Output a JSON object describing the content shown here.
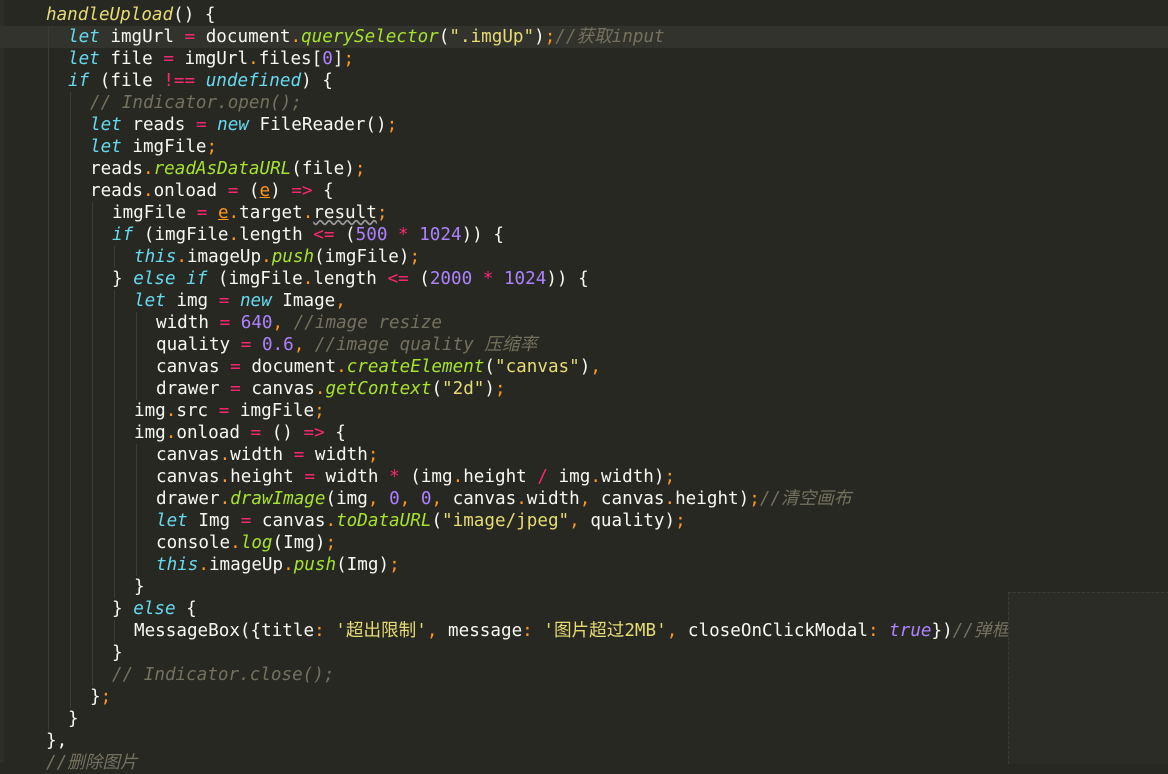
{
  "editor": {
    "theme_colors": {
      "background": "#272822",
      "keyword": "#66d9ef",
      "operator": "#f92672",
      "function": "#a6e22e",
      "string": "#e6db74",
      "number": "#ae81ff",
      "comment": "#75715e"
    },
    "lines": [
      {
        "indent": 1,
        "tokens": [
          [
            "fnm",
            "handleUpload"
          ],
          [
            "pu",
            "() {"
          ]
        ]
      },
      {
        "indent": 2,
        "current": true,
        "tokens": [
          [
            "kw",
            "let"
          ],
          [
            "pu",
            " imgUrl "
          ],
          [
            "op",
            "="
          ],
          [
            "pu",
            " document"
          ],
          [
            "sep",
            "."
          ],
          [
            "fn",
            "querySelector"
          ],
          [
            "pu",
            "("
          ],
          [
            "str",
            "\".imgUp\""
          ],
          [
            "pu",
            ")"
          ],
          [
            "sep",
            ";"
          ],
          [
            "cm",
            "//获取input"
          ]
        ]
      },
      {
        "indent": 2,
        "tokens": [
          [
            "kw",
            "let"
          ],
          [
            "pu",
            " file "
          ],
          [
            "op",
            "="
          ],
          [
            "pu",
            " imgUrl"
          ],
          [
            "sep",
            "."
          ],
          [
            "pu",
            "files["
          ],
          [
            "num",
            "0"
          ],
          [
            "pu",
            "]"
          ],
          [
            "sep",
            ";"
          ]
        ]
      },
      {
        "indent": 2,
        "tokens": [
          [
            "kw",
            "if"
          ],
          [
            "pu",
            " (file "
          ],
          [
            "op",
            "!=="
          ],
          [
            "pu",
            " "
          ],
          [
            "kw",
            "undefined"
          ],
          [
            "pu",
            ") {"
          ]
        ]
      },
      {
        "indent": 3,
        "tokens": [
          [
            "cm",
            "// Indicator.open();"
          ]
        ]
      },
      {
        "indent": 3,
        "tokens": [
          [
            "kw",
            "let"
          ],
          [
            "pu",
            " reads "
          ],
          [
            "op",
            "="
          ],
          [
            "pu",
            " "
          ],
          [
            "kw",
            "new"
          ],
          [
            "pu",
            " FileReader()"
          ],
          [
            "sep",
            ";"
          ]
        ]
      },
      {
        "indent": 3,
        "tokens": [
          [
            "kw",
            "let"
          ],
          [
            "pu",
            " imgFile"
          ],
          [
            "sep",
            ";"
          ]
        ]
      },
      {
        "indent": 3,
        "tokens": [
          [
            "pu",
            "reads"
          ],
          [
            "sep",
            "."
          ],
          [
            "fn",
            "readAsDataURL"
          ],
          [
            "pu",
            "(file)"
          ],
          [
            "sep",
            ";"
          ]
        ]
      },
      {
        "indent": 3,
        "tokens": [
          [
            "pu",
            "reads"
          ],
          [
            "sep",
            "."
          ],
          [
            "pu",
            "onload "
          ],
          [
            "op",
            "="
          ],
          [
            "pu",
            " ("
          ],
          [
            "param",
            "e"
          ],
          [
            "pu",
            ") "
          ],
          [
            "op",
            "=>"
          ],
          [
            "pu",
            " {"
          ]
        ]
      },
      {
        "indent": 4,
        "tokens": [
          [
            "pu",
            "imgFile "
          ],
          [
            "op",
            "="
          ],
          [
            "pu",
            " "
          ],
          [
            "param",
            "e"
          ],
          [
            "sep",
            "."
          ],
          [
            "pu",
            "target"
          ],
          [
            "sep",
            "."
          ],
          [
            "squig",
            "result"
          ],
          [
            "sep",
            ";"
          ]
        ]
      },
      {
        "indent": 4,
        "tokens": [
          [
            "kw",
            "if"
          ],
          [
            "pu",
            " (imgFile"
          ],
          [
            "sep",
            "."
          ],
          [
            "pu",
            "length "
          ],
          [
            "op",
            "<="
          ],
          [
            "pu",
            " ("
          ],
          [
            "num",
            "500"
          ],
          [
            "pu",
            " "
          ],
          [
            "op",
            "*"
          ],
          [
            "pu",
            " "
          ],
          [
            "num",
            "1024"
          ],
          [
            "pu",
            ")) {"
          ]
        ]
      },
      {
        "indent": 5,
        "tokens": [
          [
            "kw",
            "this"
          ],
          [
            "sep",
            "."
          ],
          [
            "pu",
            "imageUp"
          ],
          [
            "sep",
            "."
          ],
          [
            "fn",
            "push"
          ],
          [
            "pu",
            "(imgFile)"
          ],
          [
            "sep",
            ";"
          ]
        ]
      },
      {
        "indent": 4,
        "tokens": [
          [
            "pu",
            "} "
          ],
          [
            "kw",
            "else if"
          ],
          [
            "pu",
            " (imgFile"
          ],
          [
            "sep",
            "."
          ],
          [
            "pu",
            "length "
          ],
          [
            "op",
            "<="
          ],
          [
            "pu",
            " ("
          ],
          [
            "num",
            "2000"
          ],
          [
            "pu",
            " "
          ],
          [
            "op",
            "*"
          ],
          [
            "pu",
            " "
          ],
          [
            "num",
            "1024"
          ],
          [
            "pu",
            ")) {"
          ]
        ]
      },
      {
        "indent": 5,
        "tokens": [
          [
            "kw",
            "let"
          ],
          [
            "pu",
            " img "
          ],
          [
            "op",
            "="
          ],
          [
            "pu",
            " "
          ],
          [
            "kw",
            "new"
          ],
          [
            "pu",
            " Image"
          ],
          [
            "sep",
            ","
          ]
        ]
      },
      {
        "indent": 6,
        "tokens": [
          [
            "pu",
            "width "
          ],
          [
            "op",
            "="
          ],
          [
            "pu",
            " "
          ],
          [
            "num",
            "640"
          ],
          [
            "sep",
            ","
          ],
          [
            "pu",
            " "
          ],
          [
            "cm",
            "//image resize"
          ]
        ]
      },
      {
        "indent": 6,
        "tokens": [
          [
            "pu",
            "quality "
          ],
          [
            "op",
            "="
          ],
          [
            "pu",
            " "
          ],
          [
            "num",
            "0.6"
          ],
          [
            "sep",
            ","
          ],
          [
            "pu",
            " "
          ],
          [
            "cm",
            "//image quality 压缩率"
          ]
        ]
      },
      {
        "indent": 6,
        "tokens": [
          [
            "pu",
            "canvas "
          ],
          [
            "op",
            "="
          ],
          [
            "pu",
            " document"
          ],
          [
            "sep",
            "."
          ],
          [
            "fn",
            "createElement"
          ],
          [
            "pu",
            "("
          ],
          [
            "str",
            "\"canvas\""
          ],
          [
            "pu",
            ")"
          ],
          [
            "sep",
            ","
          ]
        ]
      },
      {
        "indent": 6,
        "tokens": [
          [
            "pu",
            "drawer "
          ],
          [
            "op",
            "="
          ],
          [
            "pu",
            " canvas"
          ],
          [
            "sep",
            "."
          ],
          [
            "fn",
            "getContext"
          ],
          [
            "pu",
            "("
          ],
          [
            "str",
            "\"2d\""
          ],
          [
            "pu",
            ")"
          ],
          [
            "sep",
            ";"
          ]
        ]
      },
      {
        "indent": 5,
        "tokens": [
          [
            "pu",
            "img"
          ],
          [
            "sep",
            "."
          ],
          [
            "pu",
            "src "
          ],
          [
            "op",
            "="
          ],
          [
            "pu",
            " imgFile"
          ],
          [
            "sep",
            ";"
          ]
        ]
      },
      {
        "indent": 5,
        "tokens": [
          [
            "pu",
            "img"
          ],
          [
            "sep",
            "."
          ],
          [
            "pu",
            "onload "
          ],
          [
            "op",
            "="
          ],
          [
            "pu",
            " () "
          ],
          [
            "op",
            "=>"
          ],
          [
            "pu",
            " {"
          ]
        ]
      },
      {
        "indent": 6,
        "tokens": [
          [
            "pu",
            "canvas"
          ],
          [
            "sep",
            "."
          ],
          [
            "pu",
            "width "
          ],
          [
            "op",
            "="
          ],
          [
            "pu",
            " width"
          ],
          [
            "sep",
            ";"
          ]
        ]
      },
      {
        "indent": 6,
        "tokens": [
          [
            "pu",
            "canvas"
          ],
          [
            "sep",
            "."
          ],
          [
            "pu",
            "height "
          ],
          [
            "op",
            "="
          ],
          [
            "pu",
            " width "
          ],
          [
            "op",
            "*"
          ],
          [
            "pu",
            " (img"
          ],
          [
            "sep",
            "."
          ],
          [
            "pu",
            "height "
          ],
          [
            "op",
            "/"
          ],
          [
            "pu",
            " img"
          ],
          [
            "sep",
            "."
          ],
          [
            "pu",
            "width)"
          ],
          [
            "sep",
            ";"
          ]
        ]
      },
      {
        "indent": 6,
        "tokens": [
          [
            "pu",
            "drawer"
          ],
          [
            "sep",
            "."
          ],
          [
            "fn",
            "drawImage"
          ],
          [
            "pu",
            "(img"
          ],
          [
            "sep",
            ","
          ],
          [
            "pu",
            " "
          ],
          [
            "num",
            "0"
          ],
          [
            "sep",
            ","
          ],
          [
            "pu",
            " "
          ],
          [
            "num",
            "0"
          ],
          [
            "sep",
            ","
          ],
          [
            "pu",
            " canvas"
          ],
          [
            "sep",
            "."
          ],
          [
            "pu",
            "width"
          ],
          [
            "sep",
            ","
          ],
          [
            "pu",
            " canvas"
          ],
          [
            "sep",
            "."
          ],
          [
            "pu",
            "height)"
          ],
          [
            "sep",
            ";"
          ],
          [
            "cm",
            "//清空画布"
          ]
        ]
      },
      {
        "indent": 6,
        "tokens": [
          [
            "kw",
            "let"
          ],
          [
            "pu",
            " Img "
          ],
          [
            "op",
            "="
          ],
          [
            "pu",
            " canvas"
          ],
          [
            "sep",
            "."
          ],
          [
            "fn",
            "toDataURL"
          ],
          [
            "pu",
            "("
          ],
          [
            "str",
            "\"image/jpeg\""
          ],
          [
            "sep",
            ","
          ],
          [
            "pu",
            " quality)"
          ],
          [
            "sep",
            ";"
          ]
        ]
      },
      {
        "indent": 6,
        "tokens": [
          [
            "pu",
            "console"
          ],
          [
            "sep",
            "."
          ],
          [
            "fn",
            "log"
          ],
          [
            "pu",
            "(Img)"
          ],
          [
            "sep",
            ";"
          ]
        ]
      },
      {
        "indent": 6,
        "tokens": [
          [
            "kw",
            "this"
          ],
          [
            "sep",
            "."
          ],
          [
            "pu",
            "imageUp"
          ],
          [
            "sep",
            "."
          ],
          [
            "fn",
            "push"
          ],
          [
            "pu",
            "(Img)"
          ],
          [
            "sep",
            ";"
          ]
        ]
      },
      {
        "indent": 5,
        "tokens": [
          [
            "pu",
            "}"
          ]
        ]
      },
      {
        "indent": 4,
        "tokens": [
          [
            "pu",
            "} "
          ],
          [
            "kw",
            "else"
          ],
          [
            "pu",
            " {"
          ]
        ]
      },
      {
        "indent": 5,
        "tokens": [
          [
            "pu",
            "MessageBox({title"
          ],
          [
            "sep",
            ":"
          ],
          [
            "pu",
            " "
          ],
          [
            "str",
            "'超出限制'"
          ],
          [
            "sep",
            ","
          ],
          [
            "pu",
            " message"
          ],
          [
            "sep",
            ":"
          ],
          [
            "pu",
            " "
          ],
          [
            "str",
            "'图片超过2MB'"
          ],
          [
            "sep",
            ","
          ],
          [
            "pu",
            " closeOnClickModal"
          ],
          [
            "sep",
            ":"
          ],
          [
            "pu",
            " "
          ],
          [
            "kw",
            "true"
          ],
          [
            "pu",
            "})"
          ],
          [
            "cm",
            "//弹框提示"
          ]
        ]
      },
      {
        "indent": 4,
        "tokens": [
          [
            "pu",
            "}"
          ]
        ]
      },
      {
        "indent": 4,
        "tokens": [
          [
            "cm",
            "// Indicator.close();"
          ]
        ]
      },
      {
        "indent": 3,
        "tokens": [
          [
            "pu",
            "}"
          ],
          [
            "sep",
            ";"
          ]
        ]
      },
      {
        "indent": 2,
        "tokens": [
          [
            "pu",
            "}"
          ]
        ]
      },
      {
        "indent": 1,
        "tokens": [
          [
            "pu",
            "},"
          ]
        ]
      },
      {
        "indent": 1,
        "tokens": [
          [
            "cm",
            "//删除图片"
          ]
        ]
      }
    ]
  }
}
